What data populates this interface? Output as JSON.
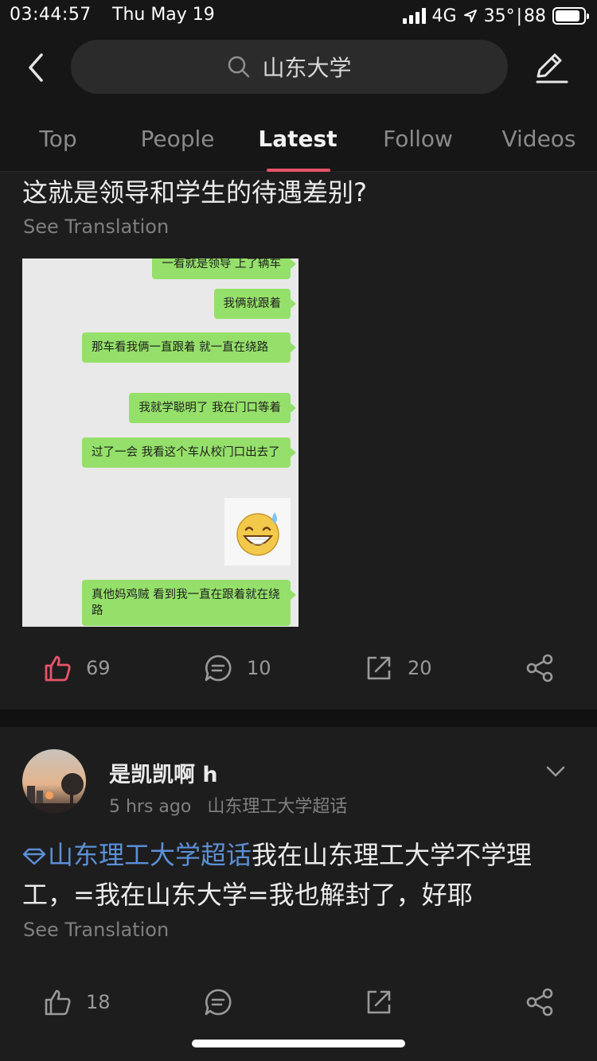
{
  "status_bar": {
    "time": "03:44:57",
    "date": "Thu May 19",
    "network": "4G",
    "weather": "35°",
    "battery": "88",
    "battery_level": 0.88
  },
  "search": {
    "query": "山东大学",
    "icon": "search-icon"
  },
  "tabs": [
    {
      "label": "Top"
    },
    {
      "label": "People"
    },
    {
      "label": "Latest"
    },
    {
      "label": "Follow"
    },
    {
      "label": "Videos"
    }
  ],
  "active_tab": "Latest",
  "colors": {
    "background": "#161616",
    "card": "#1d1d1d",
    "accent": "#e8546a",
    "topic_link": "#5b8fd6",
    "chat_bubble": "#95e06a"
  },
  "post1": {
    "text": "这就是领导和学生的待遇差别?",
    "see_translation": "See Translation",
    "image": {
      "messages": [
        "一看就是领导 上了辆车",
        "我俩就跟着",
        "那车看我俩一直跟着 就一直在绕路",
        "我就学聪明了 我在门口等着",
        "过了一会 我看这个车从校门口出去了",
        "真他妈鸡贼 看到我一直在跟着就在绕路"
      ],
      "sticker": "sweat-smile-emoji"
    },
    "likes": "69",
    "liked": true,
    "comments": "10",
    "reposts": "20"
  },
  "post2": {
    "username": "是凯凯啊 h",
    "time": "5 hrs ago",
    "source": "山东理工大学超话",
    "topic": "山东理工大学超话",
    "text": "我在山东理工大学不学理工，=我在山东大学=我也解封了，好耶",
    "see_translation": "See Translation",
    "likes": "18",
    "liked": false
  }
}
